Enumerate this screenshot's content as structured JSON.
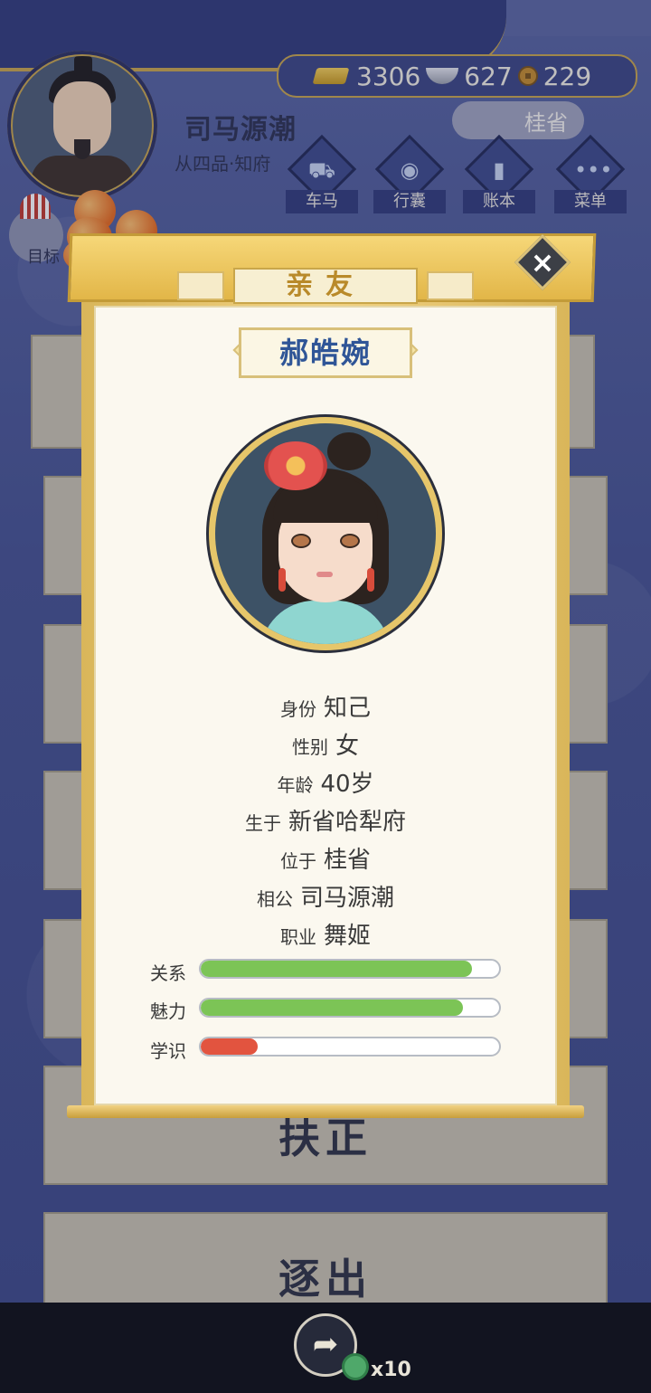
{
  "player": {
    "name": "司马源潮",
    "rank": "从四品·知府"
  },
  "currency": {
    "gold": "3306",
    "silver": "627",
    "coins": "229"
  },
  "location": "桂省",
  "menu": [
    {
      "label": "车马",
      "icon": "carriage-icon"
    },
    {
      "label": "行囊",
      "icon": "bag-icon"
    },
    {
      "label": "账本",
      "icon": "ledger-icon"
    },
    {
      "label": "菜单",
      "icon": "menu-dots-icon"
    }
  ],
  "target_label": "目标",
  "background_actions": [
    "扶正",
    "逐出"
  ],
  "dialog": {
    "title": "亲友",
    "character_name": "郝皓婉",
    "info": [
      {
        "key": "身份",
        "value": "知己"
      },
      {
        "key": "性别",
        "value": "女"
      },
      {
        "key": "年龄",
        "value": "40岁"
      },
      {
        "key": "生于",
        "value": "新省哈犁府"
      },
      {
        "key": "位于",
        "value": "桂省"
      },
      {
        "key": "相公",
        "value": "司马源潮"
      },
      {
        "key": "职业",
        "value": "舞姬"
      }
    ],
    "stats": [
      {
        "label": "关系",
        "value": 0.91,
        "color": "#7cc456"
      },
      {
        "label": "魅力",
        "value": 0.88,
        "color": "#7cc456"
      },
      {
        "label": "学识",
        "value": 0.19,
        "color": "#e2543f"
      }
    ]
  },
  "bottom": {
    "share_count": "x10"
  }
}
